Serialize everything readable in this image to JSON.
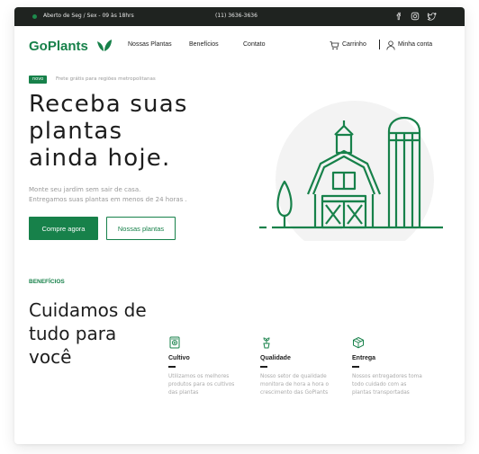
{
  "topbar": {
    "hours": "Aberto de Seg / Sex - 09 às 18hrs",
    "phone": "(11) 3636-3636",
    "social_icons": [
      "facebook-icon",
      "instagram-icon",
      "twitter-icon"
    ]
  },
  "nav": {
    "logo": "GoPlants",
    "links": [
      "Nossas Plantas",
      "Benefícios",
      "Contato"
    ],
    "cart": "Carrinho",
    "account": "Minha conta"
  },
  "hero": {
    "badge": "novo",
    "shipping_note": "Frete grátis para regiões metropolitanas",
    "title_lines": [
      "Receba suas",
      "plantas",
      "ainda hoje."
    ],
    "subtitle_lines": [
      "Monte seu jardim sem sair de casa.",
      "Entregamos suas plantas em menos de 24 horas ."
    ],
    "cta_primary": "Compre agora",
    "cta_secondary": "Nossas plantas"
  },
  "benefits": {
    "kicker": "BENEFÍCIOS",
    "title_lines": [
      "Cuidamos de",
      "tudo para",
      "você"
    ],
    "cards": [
      {
        "icon": "seed-packet-icon",
        "title": "Cultivo",
        "desc": [
          "Utilizamos os melhores",
          "produtos para os cultivos",
          "das plantas"
        ]
      },
      {
        "icon": "potted-plant-icon",
        "title": "Qualidade",
        "desc": [
          "Nosso setor de qualidade",
          "monitora de hora a hora o",
          "crescimento das GoPlants"
        ]
      },
      {
        "icon": "package-icon",
        "title": "Entrega",
        "desc": [
          "Nossos entregadores toma",
          "todo cuidado com as",
          "plantas transportadas"
        ]
      }
    ]
  },
  "colors": {
    "brand": "#17814a",
    "topbar_bg": "#1f2320",
    "text_dark": "#1d1d1d",
    "text_muted": "#999999"
  }
}
